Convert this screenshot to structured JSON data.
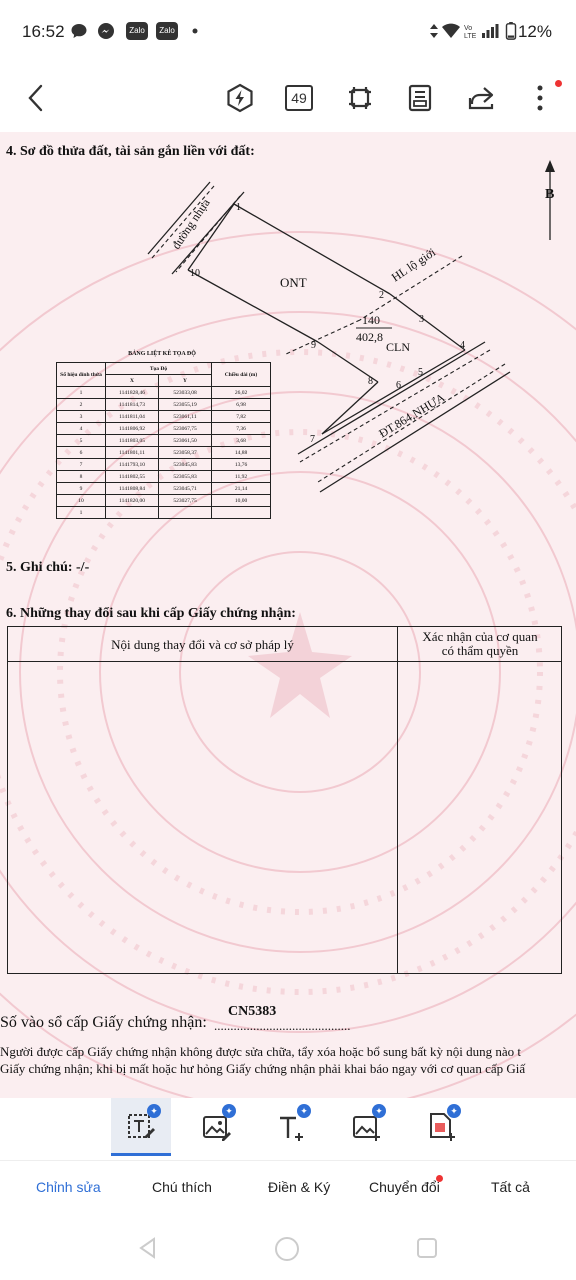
{
  "status": {
    "time": "16:52",
    "battery": "12%",
    "apps": [
      "Zalo",
      "Zalo"
    ]
  },
  "toolbar": {
    "page_count": "49"
  },
  "document": {
    "section4_title": "4. Sơ đồ thửa đất, tài sản gắn liền với đất:",
    "map": {
      "north_label": "B",
      "road_label": "đường nhựa",
      "boundary_label": "HL lộ giới",
      "highway_label": "ĐT.864,NHỰA",
      "land_type_ont": "ONT",
      "parcel_number": "140",
      "parcel_area": "402,8",
      "land_type_cln": "CLN",
      "points": [
        "1",
        "2",
        "3",
        "4",
        "5",
        "6",
        "7",
        "8",
        "9",
        "10"
      ]
    },
    "coord_table": {
      "title": "BẢNG LIỆT KÊ TỌA ĐỘ",
      "header_point": "Số hiệu đỉnh thửa",
      "header_coord": "Tọa Độ",
      "header_x": "X",
      "header_y": "Y",
      "header_length": "Chiều dài (m)",
      "rows": [
        [
          "1",
          "1141828,46",
          "523033,08",
          "26,02"
        ],
        [
          "2",
          "1141814,73",
          "523055,19",
          "6,98"
        ],
        [
          "3",
          "1141811,04",
          "523061,11",
          "7,82"
        ],
        [
          "4",
          "1141806,92",
          "523067,75",
          "7,36"
        ],
        [
          "5",
          "1141803,05",
          "523061,50",
          "3,68"
        ],
        [
          "6",
          "1141801,11",
          "523058,37",
          "14,88"
        ],
        [
          "7",
          "1141793,10",
          "523045,83",
          "13,76"
        ],
        [
          "8",
          "1141802,55",
          "523055,83",
          "11,92"
        ],
        [
          "9",
          "1141808,84",
          "523045,71",
          "21,14"
        ],
        [
          "10",
          "1141820,00",
          "523027,75",
          "10,00"
        ],
        [
          "1",
          "",
          "",
          ""
        ]
      ]
    },
    "section5": "5. Ghi chú: -/-",
    "section6_title": "6. Những thay đổi sau khi cấp Giấy chứng nhận:",
    "change_table": {
      "col1": "Nội dung thay đổi và cơ sở pháp lý",
      "col2_line1": "Xác nhận của cơ quan",
      "col2_line2": "có thẩm quyền"
    },
    "register_label": "Số vào sổ cấp Giấy chứng nhận:",
    "register_dots": "..........................................",
    "register_number": "CN5383",
    "note_line1": "Người được cấp Giấy chứng nhận không được sửa chữa, tẩy xóa hoặc bổ sung bất kỳ nội dung nào t",
    "note_line2": "Giấy chứng nhận; khi bị mất hoặc hư hỏng Giấy chứng nhận phải khai báo ngay với cơ quan cấp Giấ"
  },
  "tabs": [
    {
      "label": "Chỉnh sửa"
    },
    {
      "label": "Chú thích"
    },
    {
      "label": "Điền & Ký"
    },
    {
      "label": "Chuyển đổi"
    },
    {
      "label": "Tất cả"
    }
  ],
  "colors": {
    "accent": "#2f6fd6",
    "doc_bg": "#fbeef0",
    "alert": "#e33333"
  }
}
